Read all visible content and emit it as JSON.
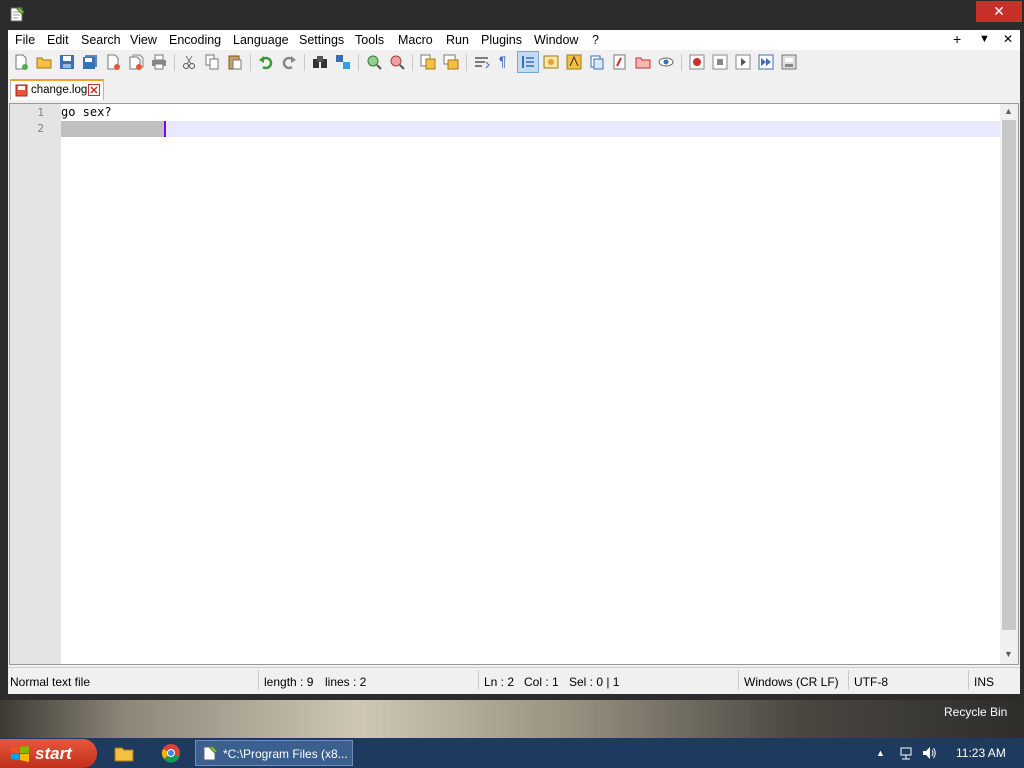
{
  "window": {
    "close_glyph": "✕"
  },
  "menu": {
    "items": [
      "File",
      "Edit",
      "Search",
      "View",
      "Encoding",
      "Language",
      "Settings",
      "Tools",
      "Macro",
      "Run",
      "Plugins",
      "Window",
      "?"
    ],
    "right_icons": [
      "+",
      "▼",
      "✕"
    ]
  },
  "tab": {
    "label": "change.log",
    "close_glyph": "✕"
  },
  "editor": {
    "lines": [
      {
        "num": "1",
        "text": "go sex?"
      },
      {
        "num": "2",
        "text": ""
      }
    ]
  },
  "status": {
    "file_type": "Normal text file",
    "length": "length : 9",
    "lines": "lines : 2",
    "ln": "Ln : 2",
    "col": "Col : 1",
    "sel": "Sel : 0 | 1",
    "eol": "Windows (CR LF)",
    "encoding": "UTF-8",
    "mode": "INS"
  },
  "desktop": {
    "recycle_bin": "Recycle Bin"
  },
  "taskbar": {
    "start_label": "start",
    "task_label": "*C:\\Program Files (x8...",
    "clock": "11:23 AM",
    "tray_arrow": "▲"
  },
  "colors": {
    "accent": "#f5a030",
    "close": "#c7302b",
    "caret": "#8000ff",
    "taskbar": "#1e3a5e"
  }
}
